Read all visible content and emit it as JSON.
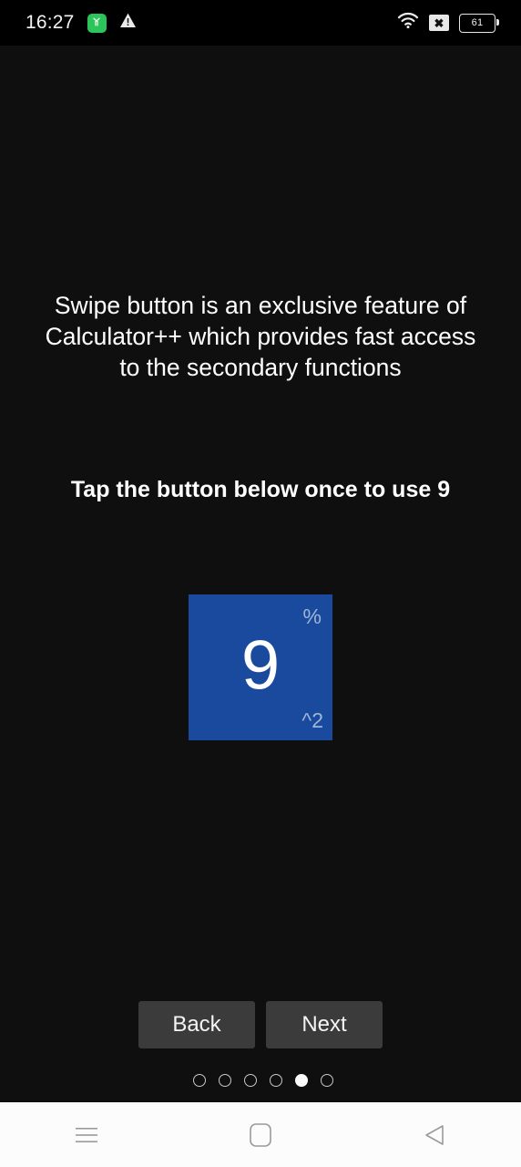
{
  "status_bar": {
    "time": "16:27",
    "app_icon_name": "green-app-badge-icon",
    "warning_icon_name": "warning-triangle-icon",
    "wifi_icon_name": "wifi-icon",
    "no_signal_icon_label": "✖",
    "battery_level": "61"
  },
  "screen": {
    "intro_text": "Swipe button is an exclusive feature of Calculator++ which provides fast access to the secondary functions",
    "instruction_text": "Tap the button below once to use 9",
    "swipe_button": {
      "main_label": "9",
      "top_right_label": "%",
      "bottom_right_label": "^2",
      "color": "#1a4a9e",
      "corner_text_color": "#9fb6d8"
    },
    "wizard": {
      "back_label": "Back",
      "next_label": "Next",
      "total_pages": 6,
      "active_page": 5
    }
  },
  "system_nav": {
    "recents_label": "recents-icon",
    "home_label": "home-icon",
    "back_label": "back-icon"
  },
  "colors": {
    "background": "#0f0f0f",
    "status_bar": "#000000",
    "button_gray": "#3b3b3b",
    "accent_blue": "#1a4a9e",
    "nav_bar": "#fcfcfc"
  }
}
